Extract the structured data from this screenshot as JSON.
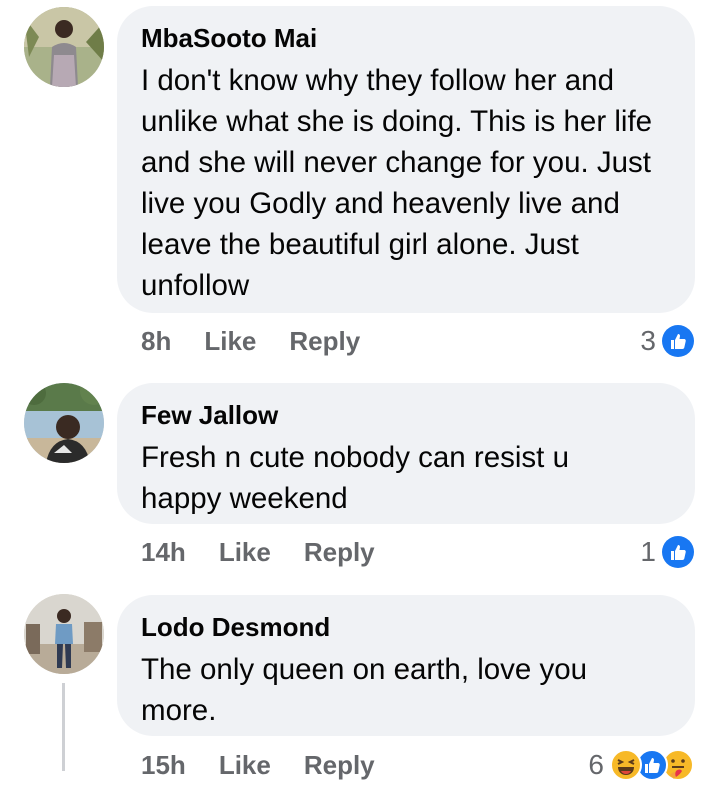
{
  "comments": [
    {
      "author": "MbaSooto Mai",
      "text": "I don't know why they follow her and unlike what she is doing. This is her life and she will never change for you. Just live you Godly and heavenly live and leave the beautiful girl alone. Just unfollow",
      "time": "8h",
      "like_label": "Like",
      "reply_label": "Reply",
      "reaction_count": "3",
      "reactions": [
        "like-icon"
      ]
    },
    {
      "author": "Few Jallow",
      "text": "Fresh n cute nobody can resist u happy weekend",
      "time": "14h",
      "like_label": "Like",
      "reply_label": "Reply",
      "reaction_count": "1",
      "reactions": [
        "like-icon"
      ]
    },
    {
      "author": "Lodo Desmond",
      "text": "The only queen on earth, love you more.",
      "time": "15h",
      "like_label": "Like",
      "reply_label": "Reply",
      "reaction_count": "6",
      "reactions": [
        "haha-icon",
        "like-icon",
        "care-icon"
      ]
    }
  ],
  "colors": {
    "bubble": "#f0f2f5",
    "meta_text": "#65676b",
    "like_blue": "#1877f2",
    "haha_yellow": "#f7b928"
  }
}
